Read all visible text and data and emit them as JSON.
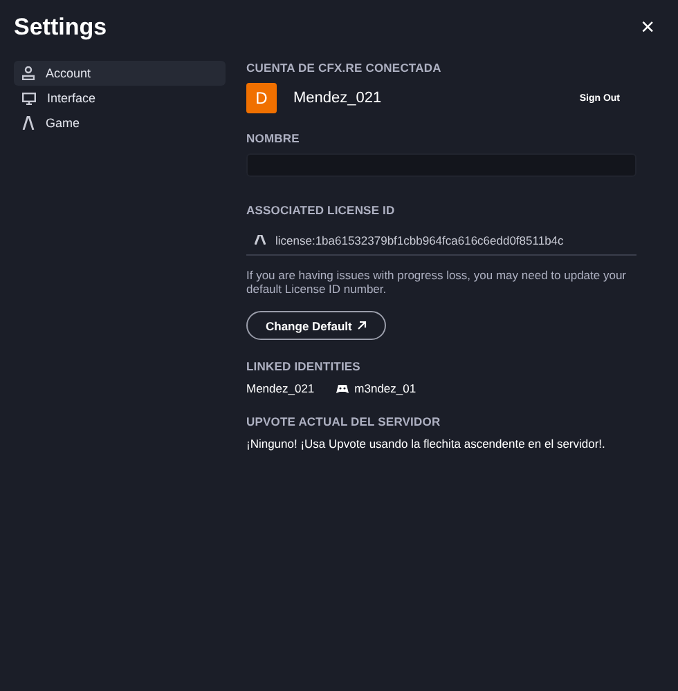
{
  "window": {
    "title": "Settings",
    "close": "×"
  },
  "sidebar": {
    "items": [
      {
        "label": "Account",
        "selected": true
      },
      {
        "label": "Interface",
        "selected": false
      },
      {
        "label": "Game",
        "selected": false
      }
    ]
  },
  "account": {
    "heading": "CUENTA DE CFX.RE CONECTADA",
    "avatar_letter": "D",
    "username": "Mendez_021",
    "sign_out": "Sign Out"
  },
  "name_field": {
    "heading": "NOMBRE"
  },
  "license": {
    "heading": "ASSOCIATED LICENSE ID",
    "value": "license:1ba61532379bf1cbb964fca616c6edd0f8511b4c",
    "help": "If you are having issues with progress loss, you may need to update your default License ID number.",
    "button": "Change Default"
  },
  "linked": {
    "heading": "LINKED IDENTITIES",
    "identities": [
      {
        "kind": "plain",
        "label": "Mendez_021"
      },
      {
        "kind": "chat",
        "label": "m3ndez_01"
      }
    ]
  },
  "upvote": {
    "heading": "UPVOTE ACTUAL DEL SERVIDOR",
    "text": "¡Ninguno! ¡Usa Upvote usando la flechita ascendente en el servidor!."
  }
}
